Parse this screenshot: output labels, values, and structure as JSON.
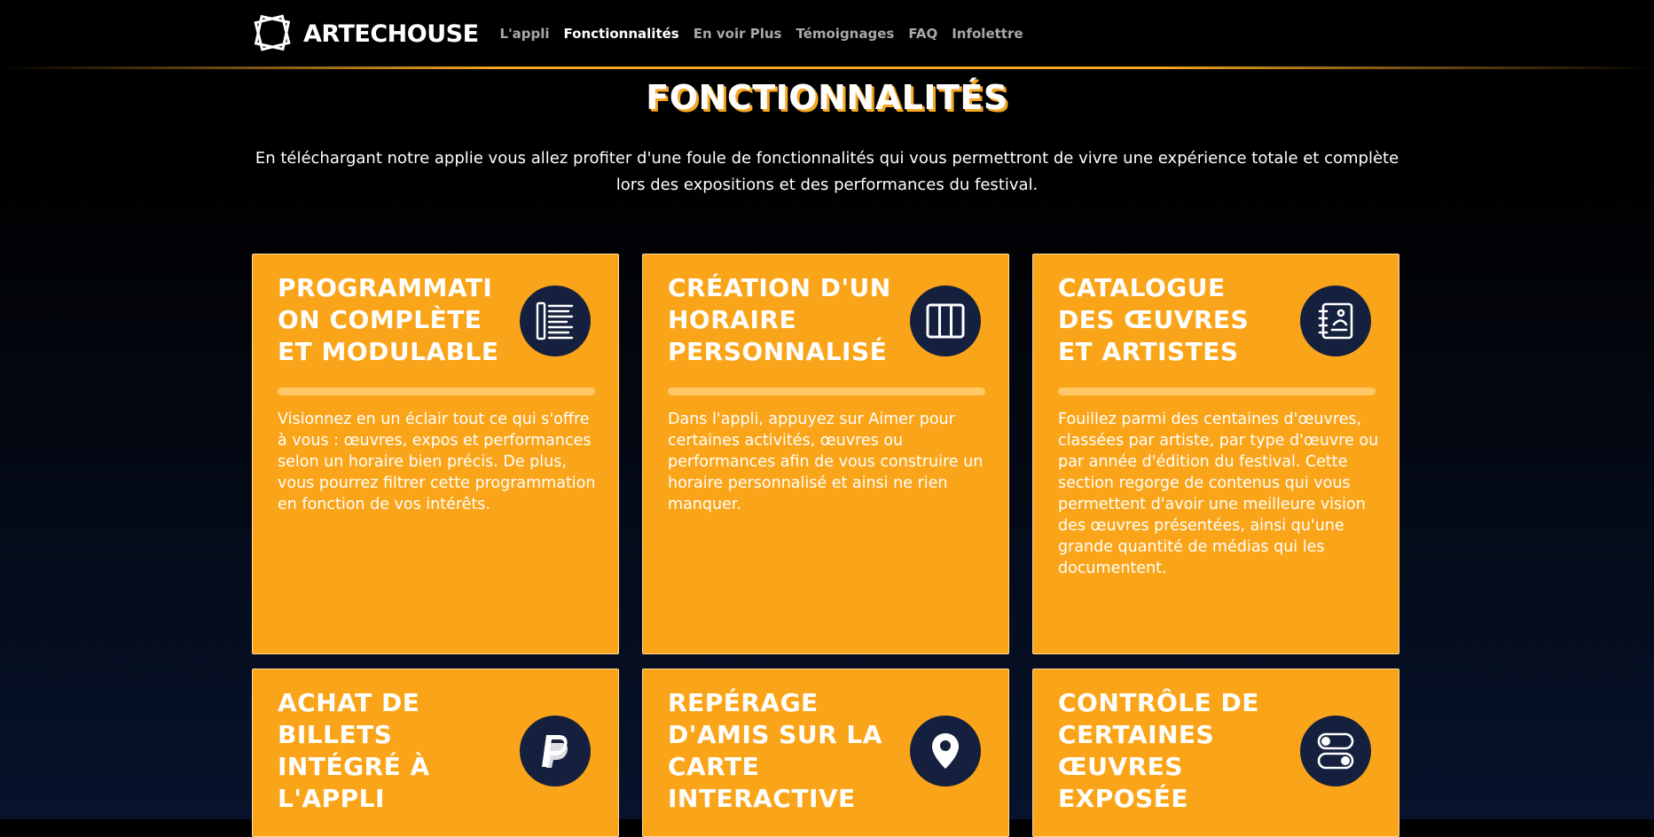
{
  "brand": {
    "name": "ARTECHOUSE"
  },
  "nav": {
    "links": [
      {
        "label": "L'appli",
        "active": false
      },
      {
        "label": "Fonctionnalités",
        "active": true
      },
      {
        "label": "En voir Plus",
        "active": false
      },
      {
        "label": "Témoignages",
        "active": false
      },
      {
        "label": "FAQ",
        "active": false
      },
      {
        "label": "Infolettre",
        "active": false
      }
    ]
  },
  "section": {
    "title": "FONCTIONNALITÉS",
    "intro_line1": "En téléchargant notre applie vous allez profiter d'une foule de fonctionnalités qui vous permettront de vivre une expérience totale et complète",
    "intro_line2": "lors des expositions et des performances du festival."
  },
  "colors": {
    "accent": "#faa519",
    "icon_bg": "#14203d",
    "background_top": "#000000",
    "background_bottom": "#07132c"
  },
  "cards": [
    {
      "title": "PROGRAMMATI ON COMPLÈTE ET MODULABLE",
      "icon": "list-icon",
      "description": "Visionnez en un éclair tout ce qui s'offre à vous : œuvres, expos et performances selon un horaire bien précis. De plus, vous pourrez filtrer cette programmation en fonction de vos intérêts."
    },
    {
      "title": "CRÉATION D'UN HORAIRE PERSONNALISÉ",
      "icon": "columns-icon",
      "description": "Dans l'appli, appuyez sur Aimer pour certaines activités, œuvres ou performances afin de vous construire un horaire personnalisé et ainsi ne rien manquer."
    },
    {
      "title": "CATALOGUE DES ŒUVRES ET ARTISTES",
      "icon": "catalog-icon",
      "description": "Fouillez parmi des centaines d'œuvres, classées par artiste, par type d'œuvre ou par année d'édition du festival. Cette section regorge de contenus qui vous permettent d'avoir une meilleure vision des œuvres présentées, ainsi qu'une grande quantité de médias qui les documentent."
    },
    {
      "title": "ACHAT DE BILLETS INTÉGRÉ À L'APPLI",
      "icon": "paypal-icon",
      "description": ""
    },
    {
      "title": "REPÉRAGE D'AMIS SUR LA CARTE INTERACTIVE",
      "icon": "map-pin-icon",
      "description": ""
    },
    {
      "title": "CONTRÔLE DE CERTAINES ŒUVRES EXPOSÉE",
      "icon": "toggle-icon",
      "description": ""
    }
  ]
}
